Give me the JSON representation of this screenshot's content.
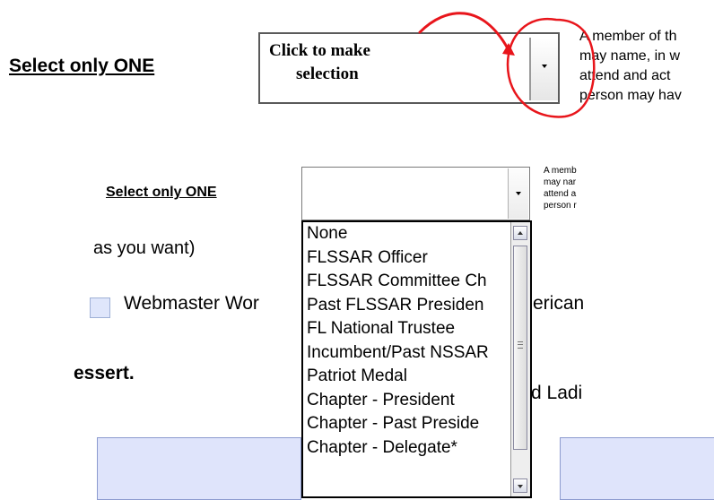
{
  "top_callout": {
    "label": "Select only ONE",
    "field_line1": "Click to make",
    "field_line2": "selection",
    "side_text": [
      "A member of th",
      "may name, in w",
      "attend and act",
      "person may hav"
    ]
  },
  "form": {
    "select_label": "Select only ONE",
    "side_text": [
      "A memb",
      "may nar",
      "attend a",
      "person r"
    ],
    "instruction_fragment": "as you want)",
    "checkbox_label": "Webmaster Wor",
    "right_fragment_1": "erican",
    "left_fragment_2": "essert.",
    "right_fragment_2": "d Ladi"
  },
  "dropdown": {
    "options": [
      "None",
      "FLSSAR Officer",
      "FLSSAR Committee Ch",
      "Past FLSSAR Presiden",
      "FL National Trustee",
      "Incumbent/Past NSSAR",
      "Patriot Medal",
      "Chapter  - President",
      "Chapter  - Past Preside",
      "Chapter  - Delegate*"
    ]
  },
  "colors": {
    "annotation_red": "#e8151b",
    "panel_fill": "#dfe4fb"
  }
}
